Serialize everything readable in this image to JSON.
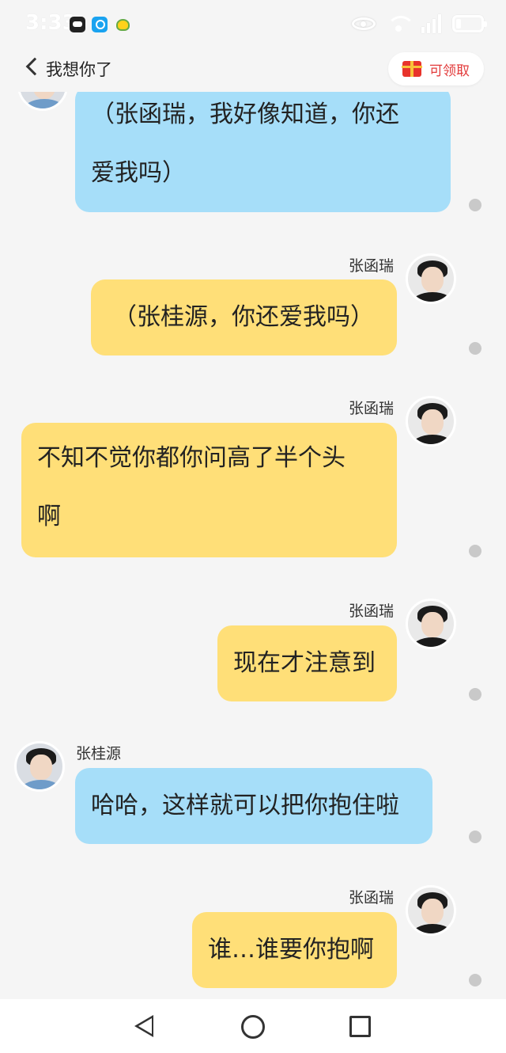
{
  "status_bar": {
    "time": "3:33"
  },
  "header": {
    "title": "我想你了",
    "claim_label": "可领取"
  },
  "messages": [
    {
      "side": "left",
      "sender": "",
      "color": "blue",
      "lines": [
        "（张函瑞，我好像知道，你还",
        "爱我吗）"
      ]
    },
    {
      "side": "right",
      "sender": "张函瑞",
      "color": "yellow",
      "lines": [
        "（张桂源，你还爱我吗）"
      ]
    },
    {
      "side": "right",
      "sender": "张函瑞",
      "color": "yellow",
      "lines": [
        "不知不觉你都你问高了半个头",
        "啊"
      ]
    },
    {
      "side": "right",
      "sender": "张函瑞",
      "color": "yellow",
      "lines": [
        "现在才注意到"
      ]
    },
    {
      "side": "left",
      "sender": "张桂源",
      "color": "blue",
      "lines": [
        "哈哈，这样就可以把你抱住啦"
      ]
    },
    {
      "side": "right",
      "sender": "张函瑞",
      "color": "yellow",
      "lines": [
        "谁…谁要你抱啊"
      ]
    }
  ],
  "colors": {
    "blue_bubble": "#a6def9",
    "yellow_bubble": "#ffdf78",
    "background": "#f5f5f5"
  },
  "navbar": {
    "icons": [
      "back-triangle-icon",
      "home-circle-icon",
      "recents-square-icon"
    ]
  }
}
